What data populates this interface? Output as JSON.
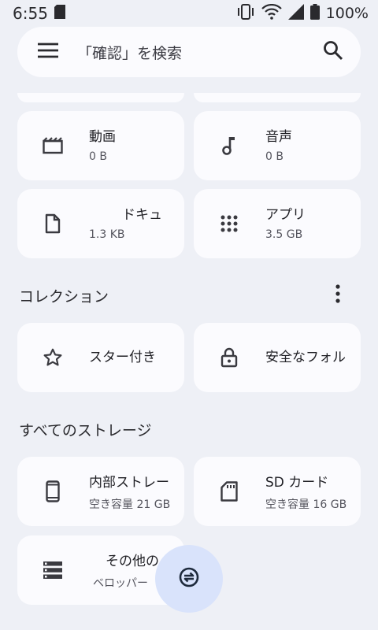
{
  "status_bar": {
    "time": "6:55",
    "battery": "100%",
    "icons": [
      "sd-card-icon",
      "vibrate-icon",
      "wifi-icon",
      "signal-icon",
      "battery-icon"
    ]
  },
  "search": {
    "placeholder": "「確認」を検索",
    "menu_icon": "menu-icon",
    "search_icon": "search-icon"
  },
  "categories": [
    {
      "title": "動画",
      "sub": "0 B",
      "icon": "video-icon"
    },
    {
      "title": "音声",
      "sub": "0 B",
      "icon": "music-icon"
    },
    {
      "title": "ドキュ",
      "sub": "1.3 KB",
      "icon": "document-icon"
    },
    {
      "title": "アプリ",
      "sub": "3.5 GB",
      "icon": "apps-icon"
    }
  ],
  "collections": {
    "title": "コレクション",
    "items": [
      {
        "title": "スター付き",
        "icon": "star-icon"
      },
      {
        "title": "安全なフォル",
        "icon": "lock-icon"
      }
    ]
  },
  "storage": {
    "title": "すべてのストレージ",
    "items": [
      {
        "title": "内部ストレー",
        "sub": "空き容量 21 GB",
        "icon": "phone-icon"
      },
      {
        "title": "SD カード",
        "sub": "空き容量 16 GB",
        "icon": "sd-card-icon"
      },
      {
        "title": "その他の",
        "sub": "ベロッパー",
        "icon": "storage-icon"
      }
    ]
  },
  "fab": {
    "icon": "sync-icon"
  },
  "colors": {
    "background": "#eef0f6",
    "card": "#fbfbfe",
    "fab": "#d9e3fb"
  }
}
